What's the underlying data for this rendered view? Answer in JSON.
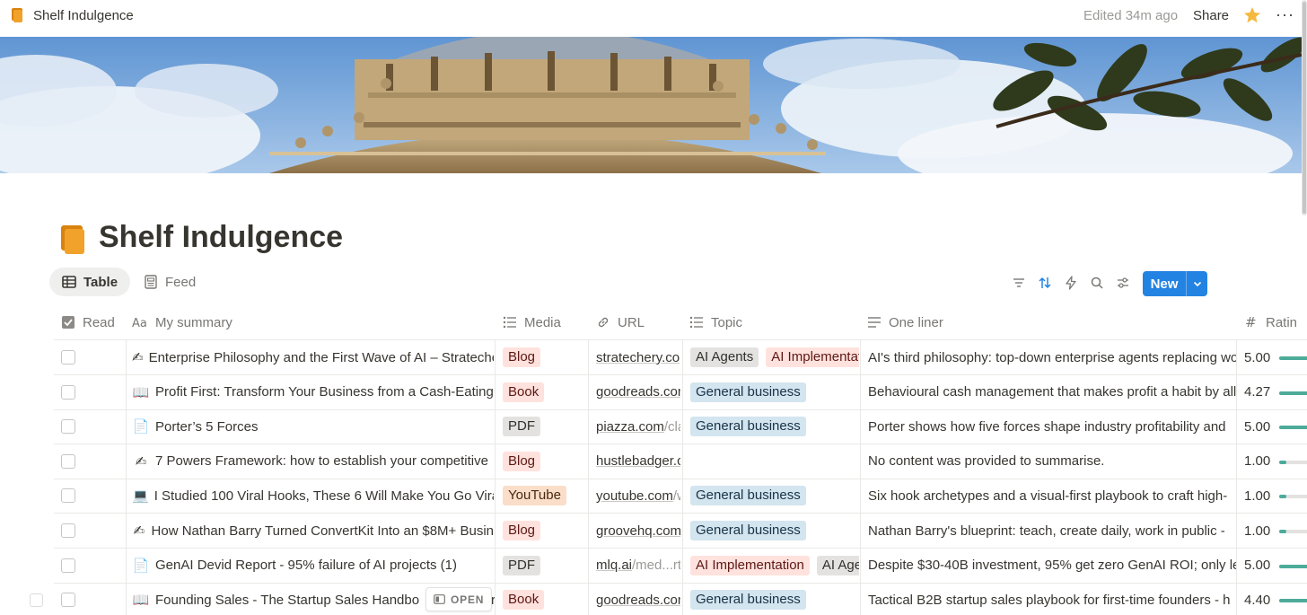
{
  "topbar": {
    "title": "Shelf Indulgence",
    "edited": "Edited 34m ago",
    "share": "Share",
    "more": "···"
  },
  "page": {
    "title": "Shelf Indulgence"
  },
  "views": [
    {
      "label": "Table",
      "icon": "table-icon",
      "active": true
    },
    {
      "label": "Feed",
      "icon": "feed-icon",
      "active": false
    }
  ],
  "toolbar": {
    "new_label": "New",
    "icons": [
      "filter-icon",
      "sort-icon",
      "automation-icon",
      "search-icon",
      "settings-icon"
    ]
  },
  "columns": {
    "read": "Read",
    "summary": "My summary",
    "media": "Media",
    "url": "URL",
    "topic": "Topic",
    "oneliner": "One liner",
    "rating": "Ratin"
  },
  "tag_colors": {
    "Blog": "#ffe2dd",
    "Book": "#ffe2dd",
    "PDF": "#e3e2e0",
    "YouTube": "#fadec9",
    "AI Agents": "#e3e2e0",
    "AI Implementation": "#ffe2dd",
    "General business": "#d3e5ef"
  },
  "rows": [
    {
      "emoji": "✍",
      "title": "Enterprise Philosophy and the First Wave of AI – Strateche",
      "media": "Blog",
      "url": "stratechery.co",
      "url_muted": "",
      "topics": [
        "AI Agents",
        "AI Implementation"
      ],
      "oneliner": "AI's third philosophy: top-down enterprise agents replacing wor",
      "rating": "5.00",
      "rating_fraction": 1.0
    },
    {
      "emoji": "📖",
      "title": "Profit First: Transform Your Business from a Cash-Eating",
      "media": "Book",
      "url": "goodreads.com",
      "url_muted": "",
      "topics": [
        "General business"
      ],
      "oneliner": "Behavioural cash management that makes profit a habit by allo",
      "rating": "4.27",
      "rating_fraction": 0.854
    },
    {
      "emoji": "📄",
      "title": "Porter’s 5 Forces",
      "media": "PDF",
      "url": "piazza.com",
      "url_muted": "/cla",
      "topics": [
        "General business"
      ],
      "oneliner": "Porter shows how five forces shape industry profitability and",
      "rating": "5.00",
      "rating_fraction": 1.0
    },
    {
      "emoji": "✍",
      "title": "7 Powers Framework: how to establish your competitive",
      "media": "Blog",
      "url": "hustlebadger.c",
      "url_muted": "",
      "topics": [],
      "oneliner": "No content was provided to summarise.",
      "rating": "1.00",
      "rating_fraction": 0.2
    },
    {
      "emoji": "💻",
      "title": "I Studied 100 Viral Hooks, These 6 Will Make You Go Vira",
      "media": "YouTube",
      "url": "youtube.com",
      "url_muted": "/w",
      "topics": [
        "General business"
      ],
      "oneliner": "Six hook archetypes and a visual-first playbook to craft high-",
      "rating": "1.00",
      "rating_fraction": 0.2
    },
    {
      "emoji": "✍",
      "title": "How Nathan Barry Turned ConvertKit Into an $8M+ Busin",
      "media": "Blog",
      "url": "groovehq.com",
      "url_muted": "",
      "topics": [
        "General business"
      ],
      "oneliner": "Nathan Barry's blueprint: teach, create daily, work in public -",
      "rating": "1.00",
      "rating_fraction": 0.2
    },
    {
      "emoji": "📄",
      "title": "GenAI Devid Report - 95% failure of AI projects (1)",
      "media": "PDF",
      "url": "mlq.ai",
      "url_muted": "/med...rt",
      "topics": [
        "AI Implementation",
        "AI Agents"
      ],
      "oneliner": "Despite $30-40B investment, 95% get zero GenAI ROI; only lea",
      "rating": "5.00",
      "rating_fraction": 1.0
    },
    {
      "emoji": "📖",
      "title": "Founding Sales - The Startup Sales Handbo",
      "media": "Book",
      "url": "goodreads.com",
      "url_muted": "",
      "topics": [
        "General business"
      ],
      "oneliner": "Tactical B2B startup sales playbook for first-time founders - h",
      "rating": "4.40",
      "rating_fraction": 0.88,
      "open_button": "OPEN",
      "title_tail": "r"
    }
  ]
}
